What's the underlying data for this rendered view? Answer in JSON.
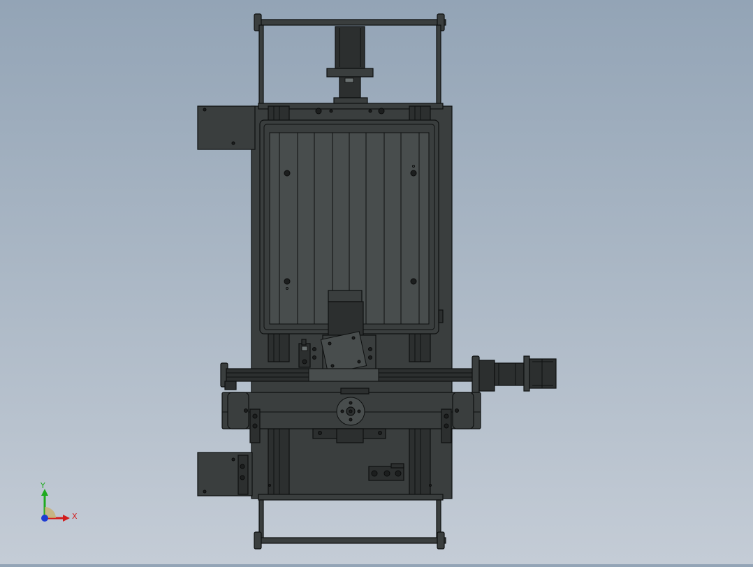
{
  "viewport": {
    "background_top": "#93a4b6",
    "background_bottom": "#c4ccd6",
    "model_color": "#3b3f3f",
    "edge_color": "#0d0f0f"
  },
  "triad": {
    "x_label": "X",
    "y_label": "Y",
    "x_color": "#d21c1c",
    "y_color": "#1faa1f",
    "z_color": "#1f3cd2"
  }
}
